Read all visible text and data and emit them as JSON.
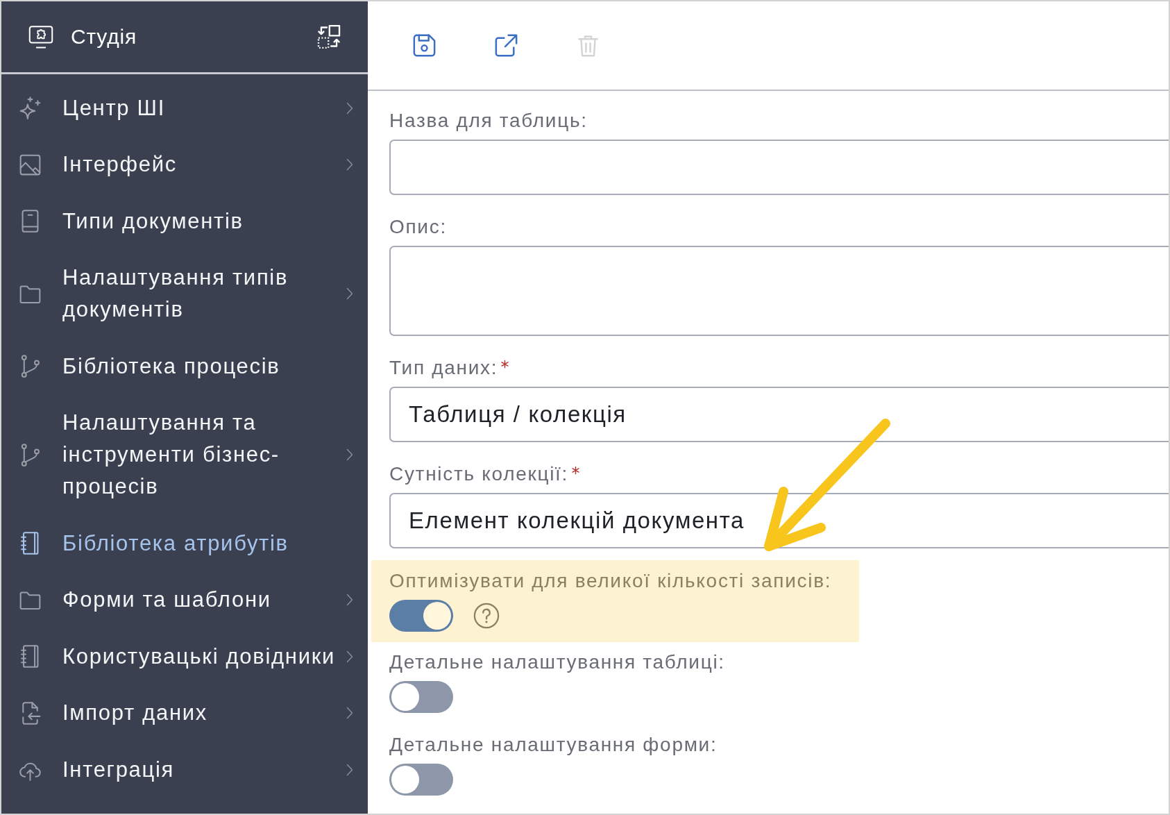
{
  "sidebar": {
    "title": "Студія",
    "items": [
      {
        "label": "Центр ШІ",
        "submenu": true,
        "selected": false
      },
      {
        "label": "Інтерфейс",
        "submenu": true,
        "selected": false
      },
      {
        "label": "Типи документів",
        "submenu": false,
        "selected": false
      },
      {
        "label": "Налаштування типів документів",
        "submenu": true,
        "selected": false
      },
      {
        "label": "Бібліотека процесів",
        "submenu": false,
        "selected": false
      },
      {
        "label": "Налаштування та інструменти бізнес-процесів",
        "submenu": true,
        "selected": false
      },
      {
        "label": "Бібліотека атрибутів",
        "submenu": false,
        "selected": true
      },
      {
        "label": "Форми та шаблони",
        "submenu": true,
        "selected": false
      },
      {
        "label": "Користувацькі довідники",
        "submenu": true,
        "selected": false
      },
      {
        "label": "Імпорт даних",
        "submenu": true,
        "selected": false
      },
      {
        "label": "Інтеграція",
        "submenu": true,
        "selected": false
      }
    ]
  },
  "toolbar": [
    {
      "disabled": false
    },
    {
      "disabled": false
    },
    {
      "disabled": true
    }
  ],
  "form": {
    "fields": [
      {
        "kind": "input",
        "label": "Назва для таблиць:",
        "required": false,
        "highlighted": false
      },
      {
        "kind": "textarea",
        "label": "Опис:",
        "required": false,
        "highlighted": false
      },
      {
        "kind": "input",
        "label": "Тип даних:",
        "required": true,
        "highlighted": false,
        "value": "Таблиця / колекція"
      },
      {
        "kind": "input",
        "label": "Сутність колекції:",
        "required": true,
        "highlighted": false,
        "value": "Елемент колекцій документа"
      },
      {
        "kind": "switch",
        "label": "Оптимізувати для великої кількості записів:",
        "required": false,
        "highlighted": true,
        "on": true,
        "help": true
      },
      {
        "kind": "switch",
        "label": "Детальне налаштування таблиці:",
        "required": false,
        "highlighted": false,
        "on": false,
        "help": false
      },
      {
        "kind": "switch",
        "label": "Детальне налаштування форми:",
        "required": false,
        "highlighted": false,
        "on": false,
        "help": false
      }
    ]
  },
  "annotations": [
    {
      "kind": "arrow"
    }
  ]
}
